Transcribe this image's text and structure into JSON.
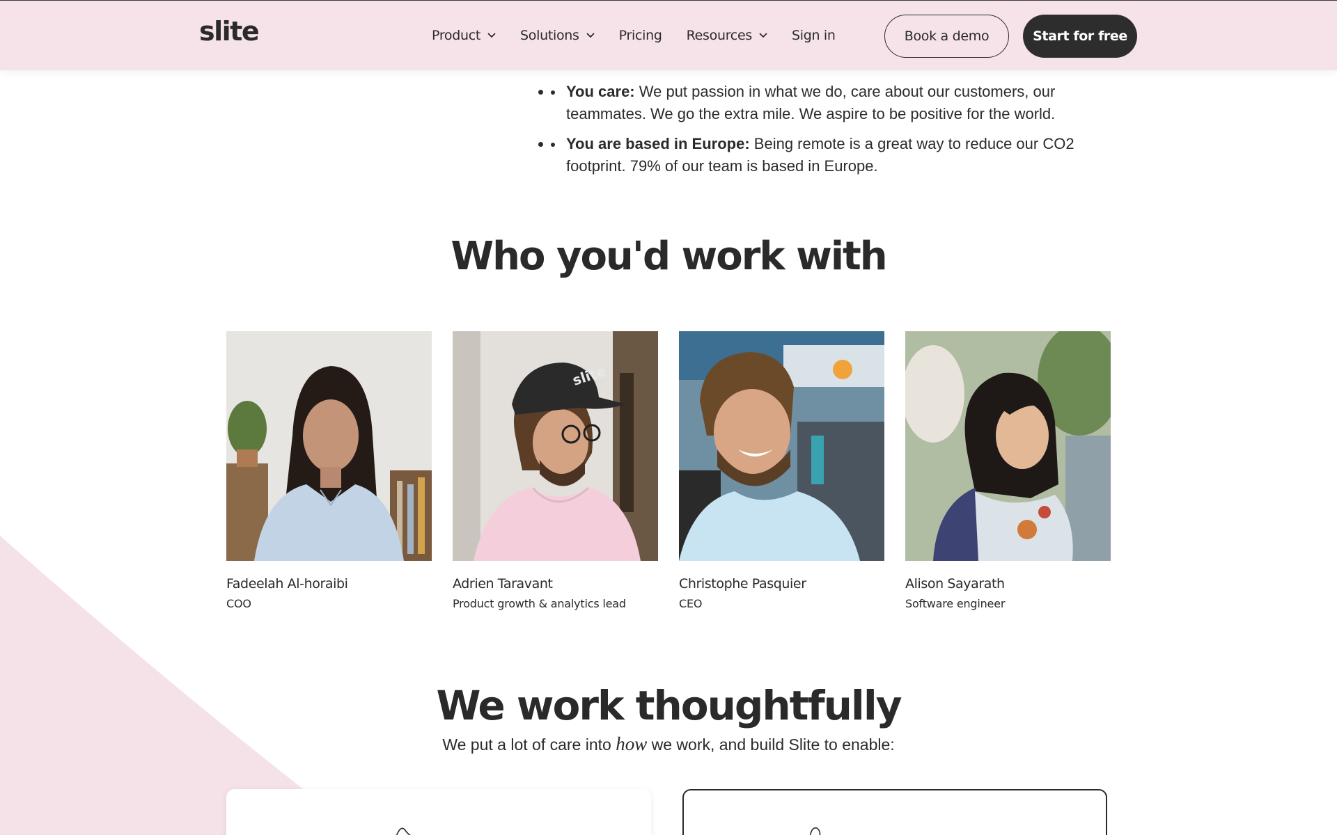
{
  "brand": {
    "logo_text": "slite"
  },
  "nav": {
    "items": [
      {
        "label": "Product",
        "has_dropdown": true
      },
      {
        "label": "Solutions",
        "has_dropdown": true
      },
      {
        "label": "Pricing",
        "has_dropdown": false
      },
      {
        "label": "Resources",
        "has_dropdown": true
      },
      {
        "label": "Sign in",
        "has_dropdown": false
      }
    ],
    "book_demo_label": "Book a demo",
    "start_free_label": "Start for free"
  },
  "values": [
    {
      "title": "You care:",
      "text": "We put passion in what we do, care about our customers, our teammates. We go the extra mile. We aspire to be positive for the world."
    },
    {
      "title": "You are based in Europe:",
      "text": "Being remote is a great way to reduce our CO2 footprint. 79% of our team is based in Europe."
    }
  ],
  "team_section": {
    "heading": "Who you'd work with",
    "members": [
      {
        "name": "Fadeelah Al-horaibi",
        "role": "COO"
      },
      {
        "name": "Adrien Taravant",
        "role": "Product growth & analytics lead"
      },
      {
        "name": "Christophe Pasquier",
        "role": "CEO"
      },
      {
        "name": "Alison Sayarath",
        "role": "Software engineer"
      }
    ]
  },
  "work_section": {
    "heading": "We work thoughtfully",
    "subtitle_before": "We put a lot of care into",
    "subtitle_emphasis": "how",
    "subtitle_after": "we work, and build Slite to enable:"
  },
  "colors": {
    "nav_bg": "#f6e3ea",
    "curve_pink": "#f5e1e8",
    "text_dark": "#2a2a2a",
    "button_dark": "#2d2d2d"
  },
  "icons": [
    "chevron-down-icon"
  ]
}
